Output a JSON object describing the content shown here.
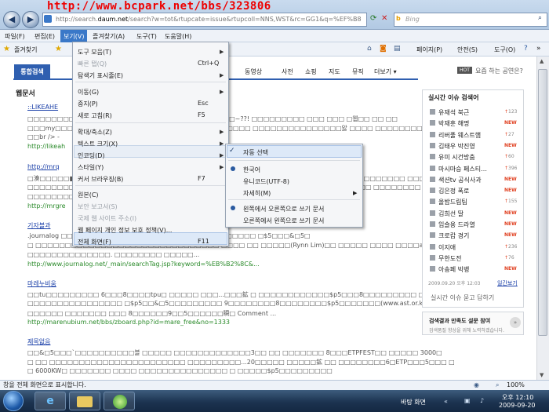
{
  "browser": {
    "watermark": "http://www.bcpark.net/bbs/323806",
    "address_domain": "daum.net",
    "address_prefix": "http://search.",
    "address_rest": "/search?w=tot&rtupcate=issue&rtupcoll=NNS,WST&rc=GG1&q=%EF%B8",
    "search_placeholder": "Bing",
    "search_icon_label": "b"
  },
  "menubar": {
    "items": [
      "파일(F)",
      "편집(E)",
      "보기(V)",
      "즐겨찾기(A)",
      "도구(T)",
      "도움말(H)"
    ]
  },
  "favbar": {
    "favorites_label": "즐겨찾기",
    "right_items": [
      "페이지(P)",
      "안전(S)",
      "도구(O)"
    ]
  },
  "view_menu": {
    "items": [
      {
        "label": "도구 모음(T)",
        "shortcut": "",
        "arrow": "▶"
      },
      {
        "label": "빠른 탭(Q)",
        "shortcut": "Ctrl+Q",
        "arrow": "",
        "dim": true
      },
      {
        "label": "탐색기 표시줄(E)",
        "shortcut": "",
        "arrow": "▶"
      },
      {
        "label": "이동(G)",
        "shortcut": "",
        "arrow": "▶"
      },
      {
        "label": "중지(P)",
        "shortcut": "Esc",
        "arrow": ""
      },
      {
        "label": "새로 고침(R)",
        "shortcut": "F5",
        "arrow": ""
      },
      {
        "label": "확대/축소(Z)",
        "shortcut": "",
        "arrow": "▶"
      },
      {
        "label": "텍스트 크기(X)",
        "shortcut": "",
        "arrow": "▶"
      },
      {
        "label": "인코딩(D)",
        "shortcut": "",
        "arrow": "▶"
      },
      {
        "label": "스타일(Y)",
        "shortcut": "",
        "arrow": "▶"
      },
      {
        "label": "커서 브라우징(B)",
        "shortcut": "F7",
        "arrow": ""
      },
      {
        "label": "원본(C)",
        "shortcut": "",
        "arrow": ""
      },
      {
        "label": "보안 보고서(S)",
        "shortcut": "",
        "arrow": "",
        "dim": true
      },
      {
        "label": "국제 웹 사이트 주소(I)",
        "shortcut": "",
        "arrow": "",
        "dim": true
      },
      {
        "label": "웹 페이지 개인 정보 보호 정책(V)...",
        "shortcut": "",
        "arrow": ""
      },
      {
        "label": "전체 화면(F)",
        "shortcut": "F11",
        "arrow": ""
      }
    ]
  },
  "encoding_submenu": {
    "items": [
      "자동 선택",
      "한국어",
      "유니코드(UTF-8)",
      "자세히(M)",
      "왼쪽에서 오른쪽으로 쓰기 문서",
      "오른쪽에서 왼쪽으로 쓰기 문서"
    ],
    "more_arrow": "▶"
  },
  "page": {
    "tabs": [
      "통합검색",
      "동영상",
      "사전",
      "쇼핑",
      "지도",
      "뮤직",
      "더보기 ▾"
    ],
    "hot_badge": "HOT",
    "hot_text": "요즘 하는 공연은?",
    "section_title": "웹문서",
    "results": [
      {
        "title": "::LIKEAHE",
        "lines": [
          "□□□□□□□□□□□□ □□□□□□□□ □□□□□ □□□□□□□□□~??! □□□□□□□□□ □□□ □□□ □웹□□ □□ □□",
          "□□□my□□□□□□□□□□□□□□□□□□□□□□□□□□□□□□□□□ □□□□□□□□□□□□□□□앓 □□□□ □□□□□□□□□□◆□□|□□ □ □□□□□□□",
          "□□br /> -"
        ],
        "url": "http://likeah"
      },
      {
        "title": "http://mrq",
        "lines": [
          "□湊□□□□□■□□□□□□□□□□ □□□□□□□□□□□□□□□□□□□□□□□□□□□□□□□□□□□□□□ □□□□□□□ □□□□□□□",
          "□□□□□□□□□□□□□□□□□□□□□□□□□□□□□□□□□□□□□□□□□□□□□□□□□□□□□□□□□□ □□□□□□□□ □□Y□□□",
          "□□□□□□□□□□□□□"
        ],
        "url": "http://mrgre"
      },
      {
        "title": "기자블과",
        "lines": [
          ".journalog □□□□□□□□ ynn Lim) 2008-10-06 15:39:51 3□□ □□□□□ □$5□□□&□5□",
          "□ □□□□□□□□□□□□□□□□□□□□□□□□□□□□□□□ □□□□ □□ □□□□□(Rynn Lim)□□ □□□□□ □□□□ □□□□a□",
          "□□□□□□□□□□□□□□. □□□□□□□□ □□□□□..."
        ],
        "url": "http://www.journalog.net/_main/searchTag.jsp?keyword=%EB%B2%8C&..."
      },
      {
        "title": "마레누비움",
        "lines": [
          "□□tu□□□□□□□□□ 6□□□8□□□□tpu□ □□□□□ □□□...□□□鉱 □ □□□□□□□□□□□□$p5□□□8□□□□□□□□□ □□d□□",
          "□□□□□□□□□□□□□□□□ □$p5□□&□5□□□□□□□□□ 9□□□□□□□□8□□□□□□□□$p5□□□□□□□(www.ast.or.kr)",
          "□□□□□□ □□□□□□□ □□□ 8□□□□□□9□□5□□□□□□瞬□ Comment ..."
        ],
        "url": "http://marenubium.net/bbs/zboard.php?id=mare_free&no=1333"
      },
      {
        "title": "제목없음",
        "lines": [
          "□□&□5□□□`□□□□□□□□□□블 □□□□□ □□□□□□□□□□□□□3□□ □□ □□□□□□□ 8□□□ETPFEST□□ □□□□□ 3000□",
          "□ □□ □□□□□□□□□□□□□□□□□□□□□□□ □□□□□□□□□...20□□□□□ □□□□□鉱 □□ □□□□□□□□6□ETP□□□5□□□ □",
          "□ 6000KW□ □□□□□□□ □□□□ □□□□□□□□□□□□□□□ □ □□□□□$p5□□□□□□□□□"
        ],
        "url": ""
      }
    ]
  },
  "issue_panel": {
    "title": "실시간 이슈 검색어",
    "items": [
      {
        "name": "유재석 북근",
        "badge": "123",
        "trend": "up"
      },
      {
        "name": "박재훈 해명",
        "badge": "NEW",
        "trend": "new"
      },
      {
        "name": "리버풀 웨스트햄",
        "badge": "27",
        "trend": "up"
      },
      {
        "name": "김태우 박진영",
        "badge": "NEW",
        "trend": "new"
      },
      {
        "name": "유미 시건방춤",
        "badge": "60",
        "trend": "up"
      },
      {
        "name": "마시마승 페스티…",
        "badge": "396",
        "trend": "up"
      },
      {
        "name": "색션tv 공식사과",
        "badge": "NEW",
        "trend": "new"
      },
      {
        "name": "김은정 폭로",
        "badge": "NEW",
        "trend": "new"
      },
      {
        "name": "올밤드림팀",
        "badge": "155",
        "trend": "up"
      },
      {
        "name": "김희선 딸",
        "badge": "NEW",
        "trend": "new"
      },
      {
        "name": "임슬용 드라열",
        "badge": "NEW",
        "trend": "new"
      },
      {
        "name": "크로캅 경기",
        "badge": "NEW",
        "trend": "new"
      },
      {
        "name": "이지애",
        "badge": "236",
        "trend": "up"
      },
      {
        "name": "무한도전",
        "badge": "76",
        "trend": "up"
      },
      {
        "name": "아송페 빅뱅",
        "badge": "NEW",
        "trend": "new"
      }
    ],
    "timestamp": "2009.09.20 오후 12:03",
    "more_link": "일간보기",
    "ask_text": "실시간 이슈 묻고 답하기",
    "survey_title": "검색결과 만족도 설문 참여",
    "survey_sub": "검색품질 향상을 위해 노력하겠습니다."
  },
  "statusbar": {
    "text": "창을 전체 화면으로 표시합니다.",
    "zoom": "100%"
  },
  "taskbar": {
    "tray_label": "바탕 화면",
    "time": "오후 12:10",
    "date": "2009-09-20"
  }
}
